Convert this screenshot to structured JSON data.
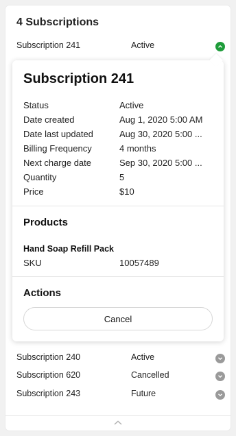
{
  "header": {
    "title": "4 Subscriptions"
  },
  "colors": {
    "active_toggle": "#1e9c3a",
    "inactive_toggle": "#9a9a9a"
  },
  "subscriptions": [
    {
      "name": "Subscription 241",
      "status": "Active",
      "expanded": true
    },
    {
      "name": "Subscription 240",
      "status": "Active",
      "expanded": false
    },
    {
      "name": "Subscription 620",
      "status": "Cancelled",
      "expanded": false
    },
    {
      "name": "Subscription 243",
      "status": "Future",
      "expanded": false
    }
  ],
  "details": {
    "title": "Subscription 241",
    "fields": [
      {
        "label": "Status",
        "value": "Active"
      },
      {
        "label": "Date created",
        "value": "Aug 1, 2020 5:00 AM"
      },
      {
        "label": "Date last updated",
        "value": "Aug 30, 2020 5:00 ..."
      },
      {
        "label": "Billing Frequency",
        "value": "4 months"
      },
      {
        "label": "Next charge date",
        "value": "Sep 30, 2020 5:00 ..."
      },
      {
        "label": "Quantity",
        "value": "5"
      },
      {
        "label": "Price",
        "value": "$10"
      }
    ],
    "products_title": "Products",
    "product": {
      "name": "Hand Soap Refill Pack",
      "sku_label": "SKU",
      "sku_value": "10057489"
    },
    "actions_title": "Actions",
    "cancel_label": "Cancel"
  },
  "icons": {
    "expanded": "chevron-up-icon",
    "collapsed": "chevron-down-icon",
    "footer": "chevron-up-icon"
  }
}
